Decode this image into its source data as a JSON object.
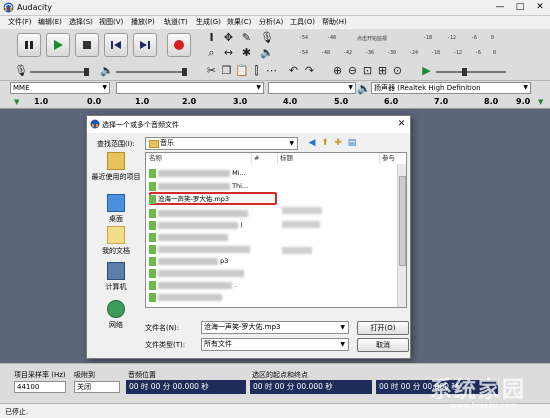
{
  "window": {
    "title": "Audacity",
    "minimize": "—",
    "maximize": "□",
    "close": "✕"
  },
  "menu": [
    "文件(F)",
    "编辑(E)",
    "选择(S)",
    "视图(V)",
    "播放(P)",
    "轨道(T)",
    "生成(G)",
    "效果(C)",
    "分析(A)",
    "工具(O)",
    "帮助(H)"
  ],
  "transport": {
    "pause": "pause-icon",
    "play": "play-icon",
    "stop": "stop-icon",
    "skip_start": "skip-start-icon",
    "skip_end": "skip-end-icon",
    "record": "record-icon"
  },
  "meter": {
    "record_scale": [
      "-54",
      "-48",
      "点击开始监视",
      "-18",
      "-12",
      "-6",
      "0"
    ],
    "play_scale": [
      "-54",
      "-48",
      "-42",
      "-36",
      "-30",
      "-24",
      "-18",
      "-12",
      "-6",
      "0"
    ]
  },
  "device": {
    "host": "MME",
    "output": "扬声器 (Realtek High Definition"
  },
  "ruler": [
    "1.0",
    "0.0",
    "1.0",
    "2.0",
    "3.0",
    "4.0",
    "5.0",
    "6.0",
    "7.0",
    "8.0",
    "9.0"
  ],
  "dialog": {
    "title": "选择一个或多个音频文件",
    "close": "✕",
    "look_in_label": "查找范围(I):",
    "look_in_value": "音乐",
    "places": [
      {
        "label": "最近使用的项目"
      },
      {
        "label": "桌面"
      },
      {
        "label": "我的文档"
      },
      {
        "label": "计算机"
      },
      {
        "label": "网络"
      }
    ],
    "columns": [
      "名称",
      "#",
      "标题",
      "参与"
    ],
    "files": [
      {
        "name": "Mi..."
      },
      {
        "name": "Thi..."
      },
      {
        "name": "沧海一声笑-罗大佑.mp3"
      },
      {
        "name": ""
      },
      {
        "name": ")"
      },
      {
        "name": ""
      },
      {
        "name": ""
      },
      {
        "name": "p3"
      },
      {
        "name": ""
      },
      {
        "name": "."
      },
      {
        "name": ""
      },
      {
        "name": ""
      }
    ],
    "filename_label": "文件名(N):",
    "filename_value": "沧海一声笑-罗大佑.mp3",
    "filetype_label": "文件类型(T):",
    "filetype_value": "所有文件",
    "open_button": "打开(O)",
    "cancel_button": "取消"
  },
  "selection_bar": {
    "rate_label": "项目采样率 (Hz)",
    "rate_value": "44100",
    "snap_label": "吸附到",
    "snap_value": "关闭",
    "position_label": "音频位置",
    "position_value": "00 时 00 分 00.000 秒",
    "range_label": "选区的起点和终点",
    "range_start": "00 时 00 分 00.000 秒",
    "range_end": "00 时 00 分 00.000 秒"
  },
  "status": "已停止.",
  "watermark": {
    "main": "系统家园",
    "sub": "www.bolezir.com"
  }
}
